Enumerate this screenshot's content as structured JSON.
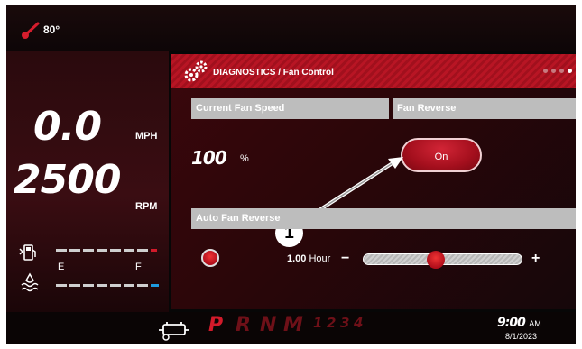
{
  "status": {
    "temperature": "80°"
  },
  "speed": {
    "value": "0.0",
    "unit": "MPH"
  },
  "engine": {
    "value": "2500",
    "unit": "RPM"
  },
  "gauges": {
    "empty_label": "E",
    "full_label": "F",
    "fuel_level": 0.9,
    "def_level": 0.9
  },
  "panel": {
    "title": "DIAGNOSTICS / Fan Control",
    "fan_speed": {
      "header": "Current Fan Speed",
      "value": "100",
      "unit": "%"
    },
    "fan_reverse": {
      "header": "Fan Reverse",
      "button_label": "On"
    },
    "auto_reverse": {
      "header": "Auto Fan Reverse",
      "interval_value": "1.00",
      "interval_unit": "Hour",
      "minus": "−",
      "plus": "+",
      "slider_level": 0.45
    }
  },
  "callout": {
    "number": "1"
  },
  "gears": {
    "p": "P",
    "r": "R",
    "n": "N",
    "m": "M",
    "gear1": "1",
    "gear2": "2",
    "gear3": "3",
    "gear4": "4"
  },
  "clock": {
    "time": "9:00",
    "ampm": "AM",
    "date": "8/1/2023"
  },
  "colors": {
    "accent": "#b81524",
    "background": "#070707",
    "gear_active": "#d21a2a",
    "gear_inactive": "#6e1018",
    "def_gauge": "#1e9be0"
  }
}
